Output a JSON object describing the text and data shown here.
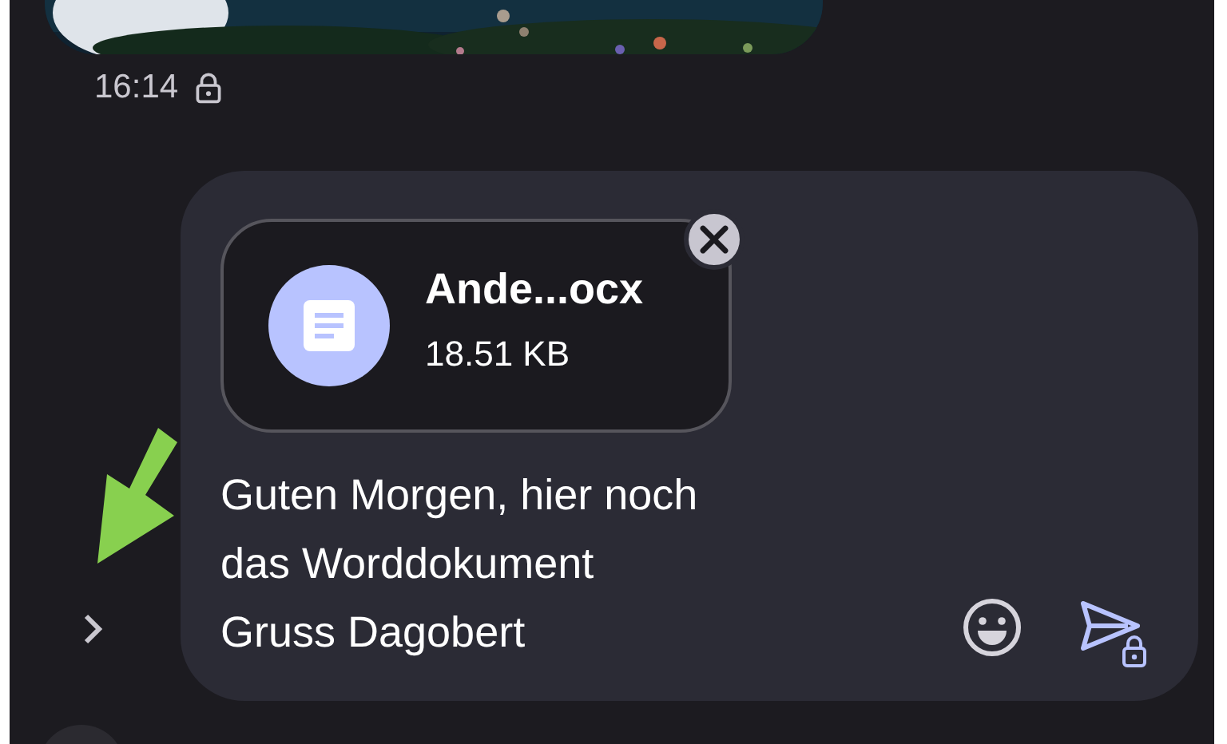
{
  "previous_message": {
    "kind": "picture",
    "time": "16:14",
    "locked": true
  },
  "composer": {
    "attachment": {
      "name": "Ande...ocx",
      "size": "18.51 KB"
    },
    "value": "Guten Morgen, hier noch\ndas Worddokument\nGruss Dagobert",
    "send_locked": true
  }
}
